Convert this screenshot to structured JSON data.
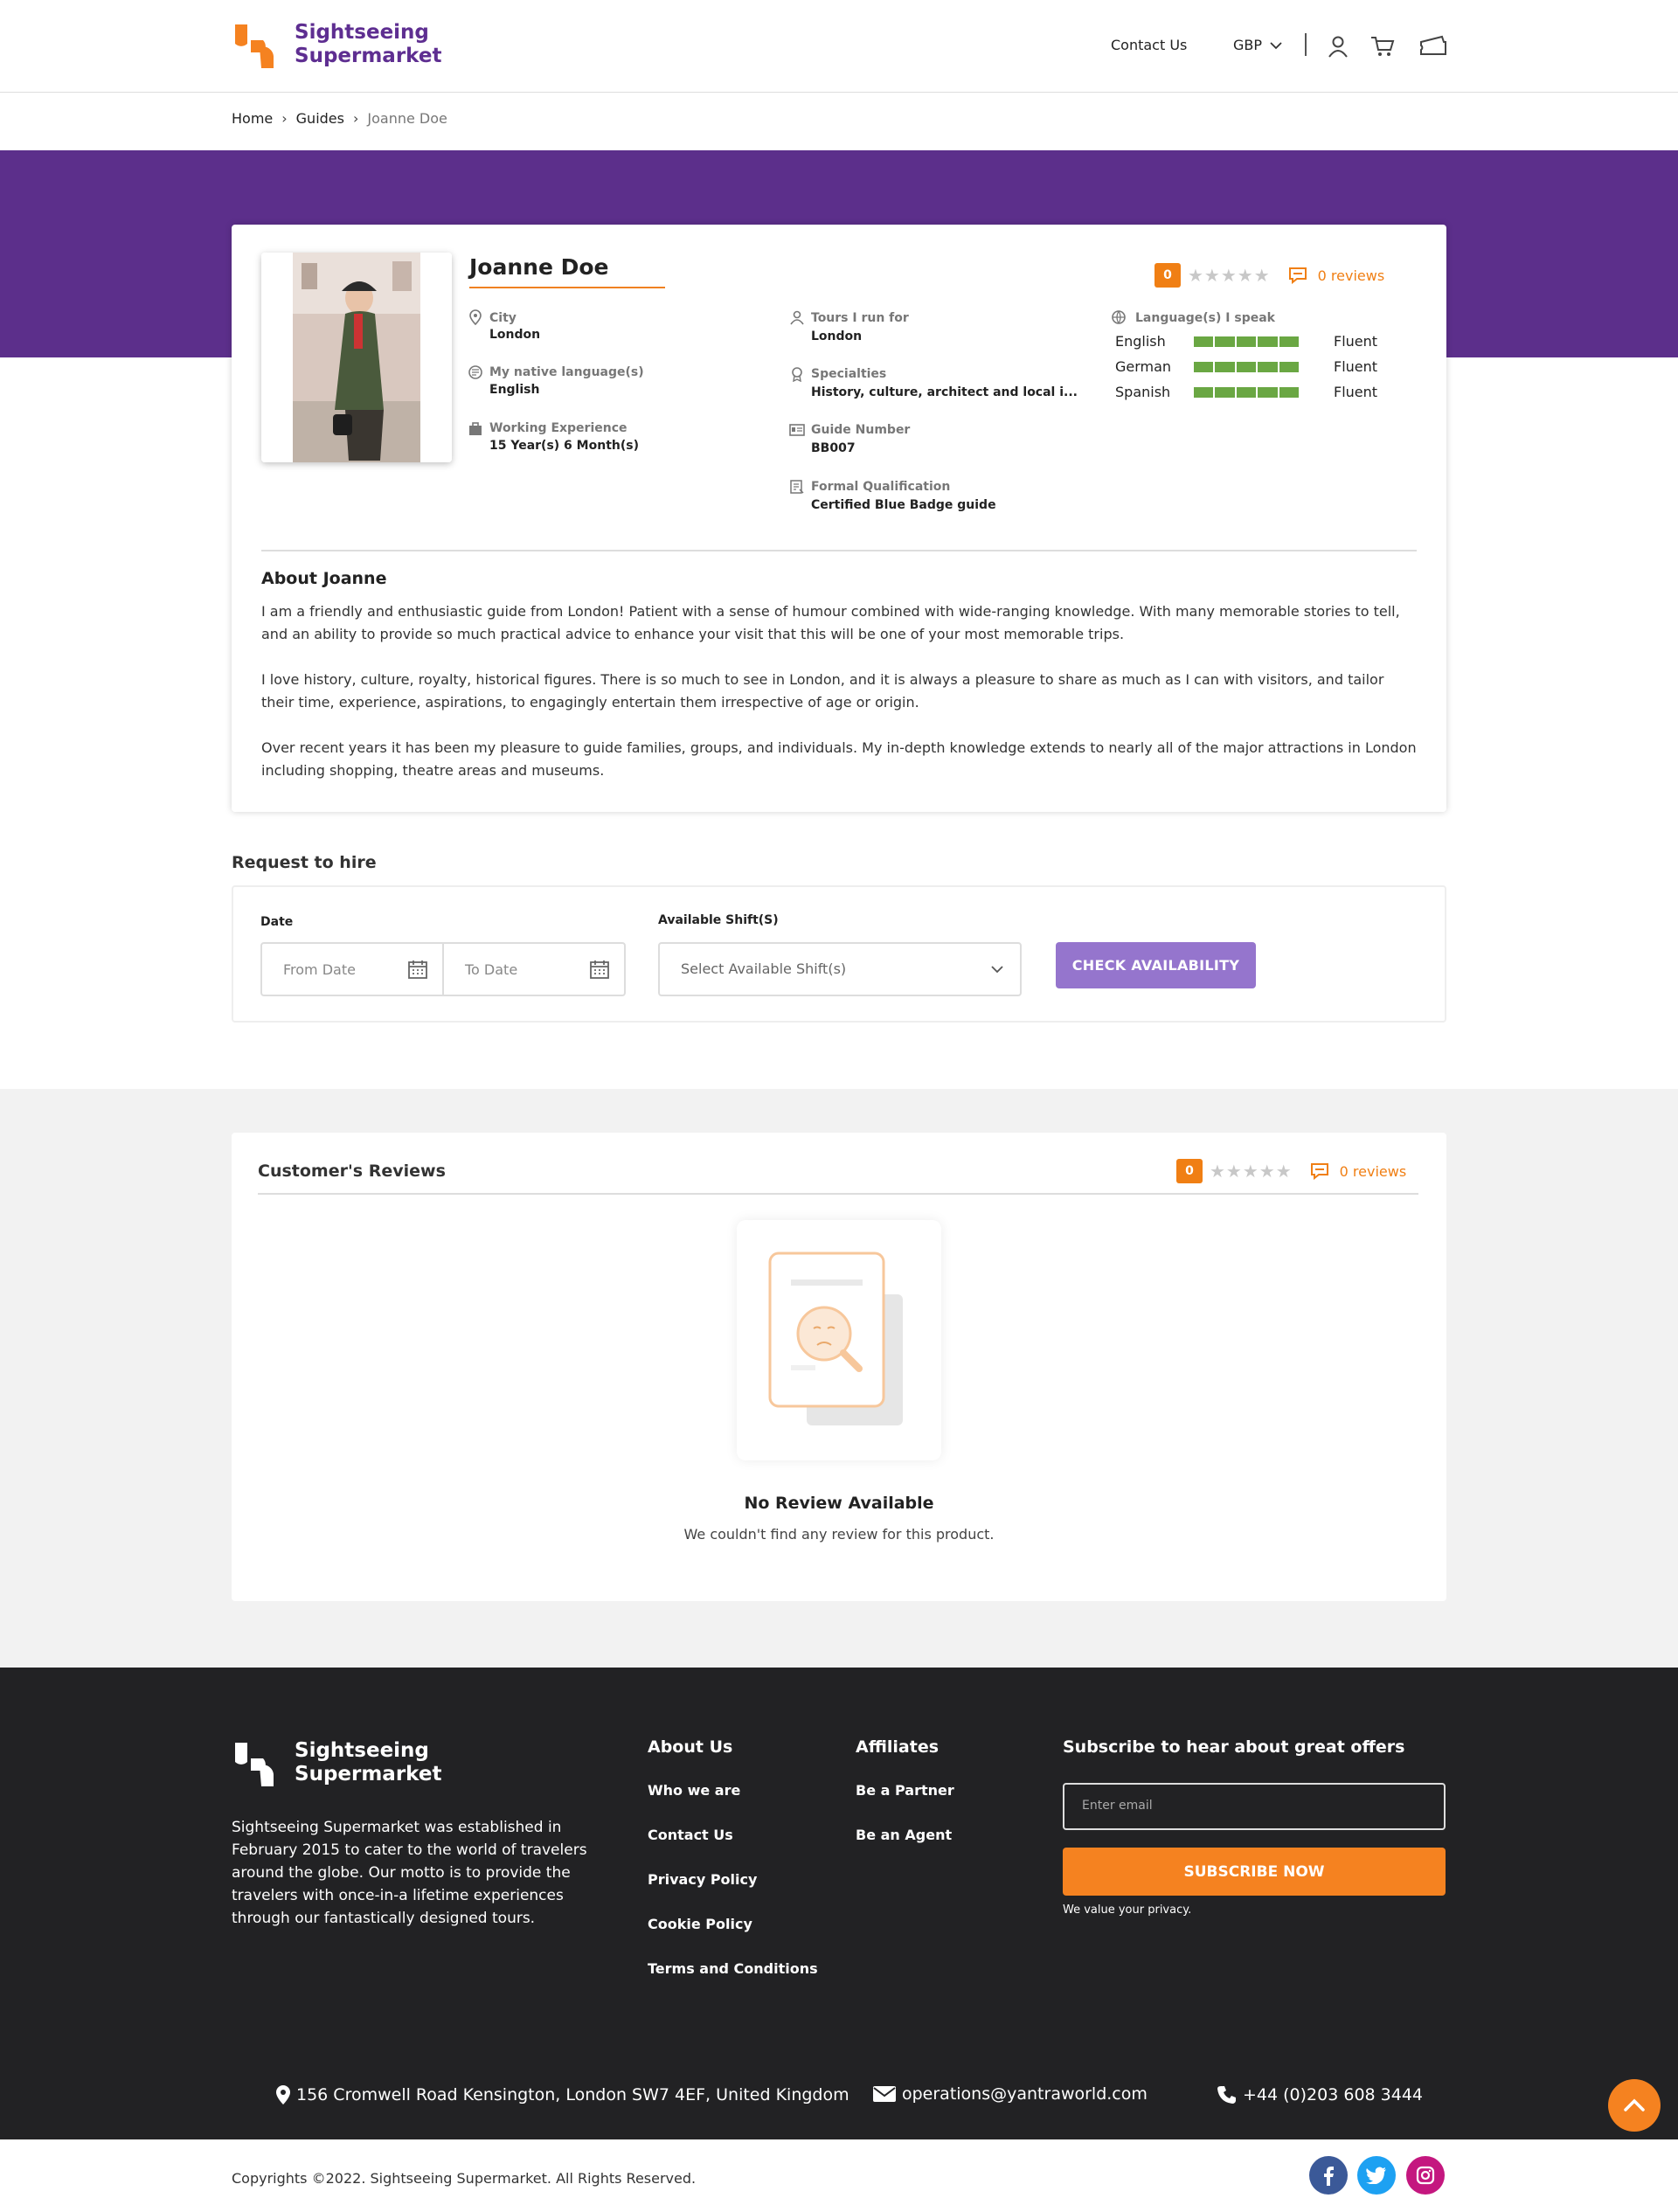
{
  "header": {
    "logo_line1": "Sightseeing",
    "logo_line2": "Supermarket",
    "contact_label": "Contact Us",
    "currency": "GBP",
    "icons": [
      "user-icon",
      "cart-icon",
      "ticket-icon"
    ]
  },
  "breadcrumb": {
    "items": [
      "Home",
      "Guides",
      "Joanne Doe"
    ]
  },
  "guide": {
    "name": "Joanne Doe",
    "rating": {
      "score": "0",
      "stars_filled": 0,
      "stars_total": 5,
      "reviews": "0 reviews"
    },
    "city_label": "City",
    "city": "London",
    "native_label": "My native language(s)",
    "native": "English",
    "experience_label": "Working Experience",
    "experience": "15 Year(s) 6 Month(s)",
    "tours_label": "Tours I run for",
    "tours": "London",
    "specialties_label": "Specialties",
    "specialties": "History, culture, architect and local i...",
    "guide_number_label": "Guide Number",
    "guide_number": "BB007",
    "qualification_label": "Formal Qualification",
    "qualification": "Certified Blue Badge guide",
    "languages_label": "Language(s) I speak",
    "languages": [
      {
        "name": "English",
        "level": "Fluent",
        "proficiency": 1.0
      },
      {
        "name": "German",
        "level": "Fluent",
        "proficiency": 1.0
      },
      {
        "name": "Spanish",
        "level": "Fluent",
        "proficiency": 1.0
      }
    ],
    "about_title": "About Joanne",
    "about": [
      "I am a friendly and enthusiastic guide from London! Patient with a sense of humour combined with wide-ranging knowledge. With many memorable stories to tell, and an ability to provide so much practical advice to enhance your visit that this will be one of your most memorable trips.",
      "I love history, culture, royalty, historical figures. There is so much to see in London, and it is always a pleasure to share as much as I can with visitors, and tailor their time, experience, aspirations, to engagingly entertain them irrespective of age or origin.",
      "Over recent years it has been my pleasure to guide families, groups, and individuals. My in-depth knowledge extends to nearly all of the major attractions in London including shopping, theatre areas and museums."
    ]
  },
  "request": {
    "title": "Request to hire",
    "date_label": "Date",
    "from_placeholder": "From Date",
    "to_placeholder": "To Date",
    "shift_label": "Available Shift(S)",
    "shift_placeholder": "Select Available Shift(s)",
    "button": "CHECK AVAILABILITY"
  },
  "reviews": {
    "title": "Customer's Reviews",
    "score": "0",
    "count": "0 reviews",
    "empty_title": "No Review Available",
    "empty_sub": "We couldn't find any review for this product."
  },
  "footer": {
    "logo_line1": "Sightseeing",
    "logo_line2": "Supermarket",
    "description": "Sightseeing Supermarket was established in February 2015 to cater to the world of travelers around the globe. Our motto is to provide the travelers with once-in-a lifetime experiences through our fantastically designed tours.",
    "about_title": "About Us",
    "about_links": [
      "Who we are",
      "Contact Us",
      "Privacy Policy",
      "Cookie Policy",
      "Terms and Conditions"
    ],
    "affiliates_title": "Affiliates",
    "affiliate_links": [
      "Be a Partner",
      "Be an Agent"
    ],
    "subscribe_title": "Subscribe to hear about great offers",
    "email_placeholder": "Enter email",
    "subscribe_button": "SUBSCRIBE NOW",
    "privacy_note": "We value your privacy.",
    "address": "156 Cromwell Road Kensington, London SW7 4EF, United Kingdom",
    "email": "operations@yantraworld.com",
    "phone": "+44 (0)203 608 3444"
  },
  "copyright": "Copyrights ©2022. Sightseeing Supermarket. All Rights Reserved.",
  "colors": {
    "brand_purple": "#5c2f8b",
    "brand_orange": "#f58220",
    "level_green": "#6aa743",
    "button_lavender": "#9575cd",
    "footer_bg": "#222224"
  }
}
